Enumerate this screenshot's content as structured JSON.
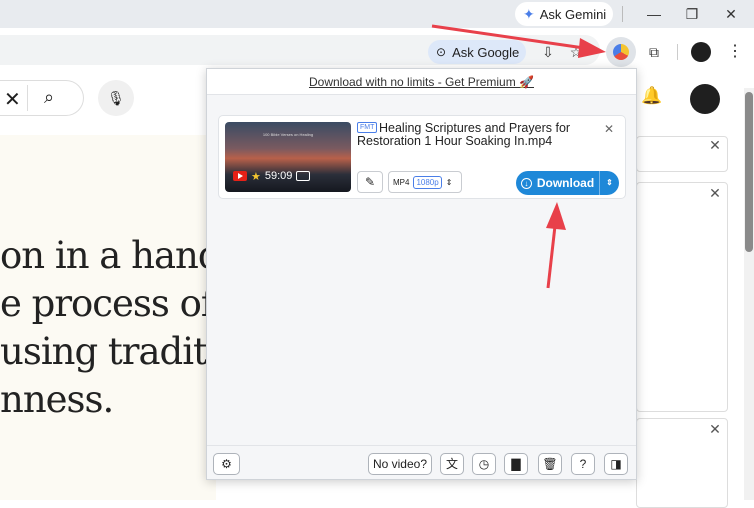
{
  "browser": {
    "gemini_label": "Ask Gemini",
    "ask_google_label": "Ask Google"
  },
  "page": {
    "article_lines": [
      "on in a hands-",
      "e process of bri",
      " using tradition",
      "nness."
    ]
  },
  "extension_popup": {
    "premium_link": "Download with no limits - Get Premium 🚀",
    "video": {
      "badge": "FMT",
      "title": "Healing Scriptures and Prayers for Restoration 1 Hour Soaking In.mp4",
      "duration": "59:09",
      "thumbnail_text": "100 Bible Verses on Healing",
      "format": "MP4",
      "resolution": "1080p",
      "download_label": "Download"
    },
    "no_video_label": "No video?"
  },
  "colors": {
    "accent": "#1e88d8",
    "annotation_arrow": "#e8404a"
  }
}
